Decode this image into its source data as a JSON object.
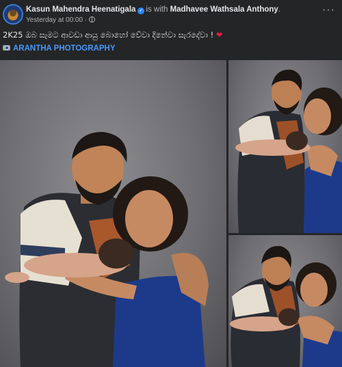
{
  "post": {
    "author": "Kasun Mahendra Heenatigala",
    "is_with_text": "is with",
    "tagged": "Madhavee Wathsala Anthony",
    "tagged_suffix": ".",
    "timestamp": "Yesterday at 00:00",
    "timestamp_separator": "·",
    "more_label": "···",
    "caption": "2K25 ඔබ සැමට ආවඩා ආයු බොහෝ වේවා දිනේවා සැරදේවා !",
    "caption_emoji": "❤",
    "credit_label": "ARANTHA PHOTOGRAPHY"
  },
  "icons": {
    "avatar": "profile-avatar",
    "verified": "verified-badge-icon",
    "privacy": "globe-icon",
    "more": "more-options-icon",
    "credit": "camera-icon"
  },
  "photos": [
    {
      "id": "main",
      "description": "couple holding newborn, studio portrait"
    },
    {
      "id": "top-right",
      "description": "couple with newborn, woman kissing man"
    },
    {
      "id": "bottom-right",
      "description": "couple with newborn, smiling"
    }
  ],
  "colors": {
    "background": "#242526",
    "text_primary": "#e4e6eb",
    "text_secondary": "#b0b3b8",
    "link": "#4599ff",
    "verified": "#2d88ff",
    "heart": "#e41e3f",
    "dress": "#1d3a8a"
  }
}
